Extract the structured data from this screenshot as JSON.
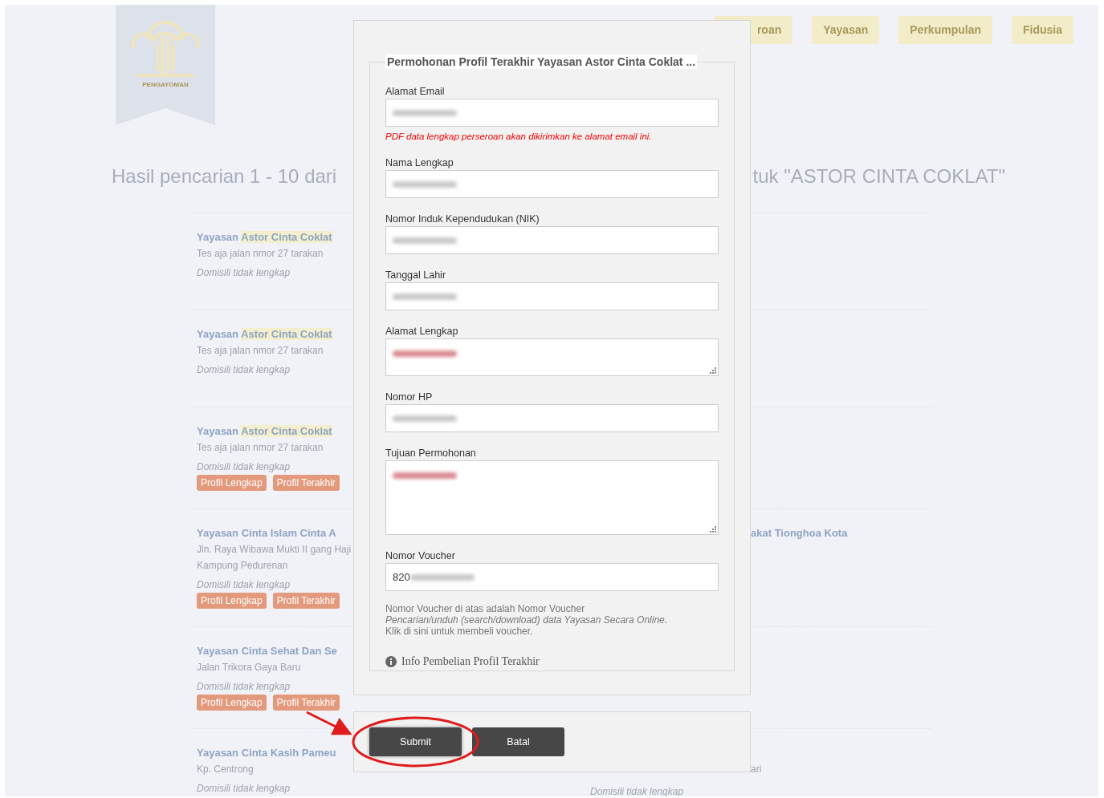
{
  "logo": {
    "caption": "PENGAYOMAN"
  },
  "nav_buttons": [
    {
      "label": "roan"
    },
    {
      "label": "Yayasan"
    },
    {
      "label": "Perkumpulan"
    },
    {
      "label": "Fidusia"
    }
  ],
  "heading": {
    "left": "Hasil pencarian 1 - 10 dari",
    "right": "tuk \"ASTOR CINTA COKLAT\""
  },
  "results": [
    {
      "title": "Yayasan",
      "highlight": "Astor Cinta Coklat",
      "address": [
        "Tes aja jalan nmor 27 tarakan"
      ],
      "domicile": "Domisili tidak lengkap"
    },
    {
      "title": "Yayasan",
      "highlight": "Astor Cinta Coklat",
      "address": [
        "Tes aja jalan nmor 27 tarakan"
      ],
      "domicile": "Domisili tidak lengkap"
    },
    {
      "title": "Yayasan",
      "highlight": "Astor Cinta Coklat",
      "address": [
        "Tes aja jalan nmor 27 tarakan"
      ],
      "domicile": "Domisili tidak lengkap",
      "buttons": [
        "Profil Lengkap",
        "Profil Terakhir"
      ]
    },
    {
      "title": "Yayasan Cinta Islam Cinta A",
      "title_right": "akat Tionghoa Kota",
      "address": [
        "Jln. Raya Wibawa Mukti II gang Haji",
        "Kampung Pedurenan"
      ],
      "domicile": "Domisili tidak lengkap",
      "buttons": [
        "Profil Lengkap",
        "Profil Terakhir"
      ]
    },
    {
      "title": "Yayasan Cinta Sehat Dan Se",
      "address": [
        "Jalan Trikora Gaya Baru"
      ],
      "domicile": "Domisili tidak lengkap",
      "buttons": [
        "Profil Lengkap",
        "Profil Terakhir"
      ]
    },
    {
      "title": "Yayasan Cinta Kasih Pameu",
      "address": [
        "Kp. Centrong"
      ],
      "address_right": "ari",
      "domicile": "Domisili tidak lengkap",
      "domicile_below_dialog": "Domisili tidak lengkap"
    }
  ],
  "dialog": {
    "legend": "Permohonan Profil Terakhir Yayasan Astor Cinta Coklat ...",
    "fields": [
      {
        "kind": "input",
        "label": "Alamat Email",
        "redacted": true,
        "hint": "PDF data lengkap perseroan akan dikirimkan ke alamat email ini."
      },
      {
        "kind": "input",
        "label": "Nama Lengkap",
        "redacted": true
      },
      {
        "kind": "input",
        "label": "Nomor Induk Kependudukan (NIK)",
        "redacted": true
      },
      {
        "kind": "input",
        "label": "Tanggal Lahir",
        "redacted": true
      },
      {
        "kind": "textarea",
        "label": "Alamat Lengkap",
        "redacted": true
      },
      {
        "kind": "input",
        "label": "Nomor HP",
        "redacted": true
      },
      {
        "kind": "memo",
        "label": "Tujuan Permohonan",
        "redacted": true
      },
      {
        "kind": "input",
        "label": "Nomor Voucher",
        "value": "820",
        "redacted": true
      }
    ],
    "help": {
      "line1": "Nomor Voucher di atas adalah Nomor Voucher",
      "line2": "Pencarian/unduh (search/download) data Yayasan Secara Online.",
      "link": "Klik di sini untuk membeli voucher."
    },
    "info": "Info Pembelian Profil Terakhir",
    "buttons": [
      {
        "label": "Submit",
        "highlighted": true
      },
      {
        "label": "Batal",
        "highlighted": false
      }
    ]
  }
}
